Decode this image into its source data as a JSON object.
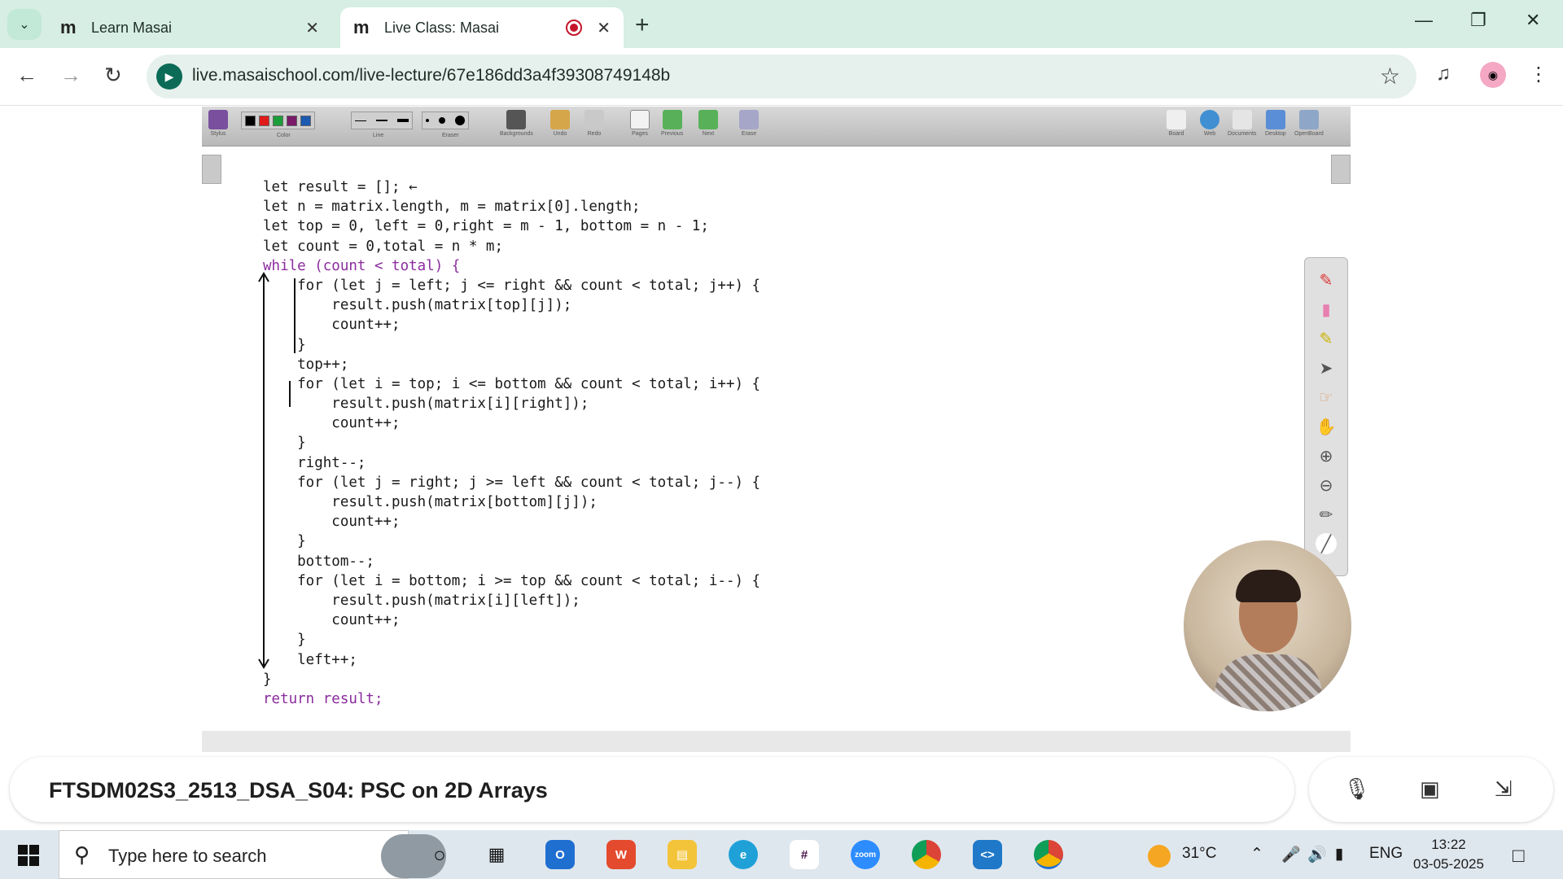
{
  "browser": {
    "tabs": [
      {
        "label": "Learn Masai",
        "favicon": "m"
      },
      {
        "label": "Live Class: Masai",
        "favicon": "m"
      }
    ],
    "url": "live.masaischool.com/live-lecture/67e186dd3a4f39308749148b"
  },
  "openboard": {
    "tools": [
      "Stylus",
      "Color",
      "Line",
      "Eraser",
      "Backgrounds",
      "Undo",
      "Redo",
      "Pages",
      "Previous",
      "Next",
      "Erase"
    ],
    "right_tools": [
      "Board",
      "Web",
      "Documents",
      "Desktop",
      "OpenBoard"
    ]
  },
  "code_lines": [
    "let result = []; ←",
    "let n = matrix.length, m = matrix[0].length;",
    "let top = 0, left = 0,right = m - 1, bottom = n - 1;",
    "let count = 0,total = n * m;",
    "while (count < total) {",
    "    for (let j = left; j <= right && count < total; j++) {",
    "        result.push(matrix[top][j]);",
    "        count++;",
    "    }",
    "    top++;",
    "    for (let i = top; i <= bottom && count < total; i++) {",
    "        result.push(matrix[i][right]);",
    "        count++;",
    "    }",
    "    right--;",
    "    for (let j = right; j >= left && count < total; j--) {",
    "        result.push(matrix[bottom][j]);",
    "        count++;",
    "    }",
    "    bottom--;",
    "    for (let i = bottom; i >= top && count < total; i--) {",
    "        result.push(matrix[i][left]);",
    "        count++;",
    "    }",
    "    left++;",
    "}",
    "return result;"
  ],
  "lecture": {
    "title": "FTSDM02S3_2513_DSA_S04: PSC on 2D Arrays"
  },
  "taskbar": {
    "search_placeholder": "Type here to search",
    "weather": "31°C",
    "language": "ENG",
    "time": "13:22",
    "date": "03-05-2025"
  },
  "icons": [
    "search-icon",
    "close-icon",
    "record-icon",
    "plus-icon",
    "minimize-icon",
    "restore-icon",
    "back-icon",
    "forward-icon",
    "reload-icon",
    "star-icon",
    "media-icon",
    "mic-off-icon",
    "camera-off-icon",
    "exit-fullscreen-icon"
  ]
}
